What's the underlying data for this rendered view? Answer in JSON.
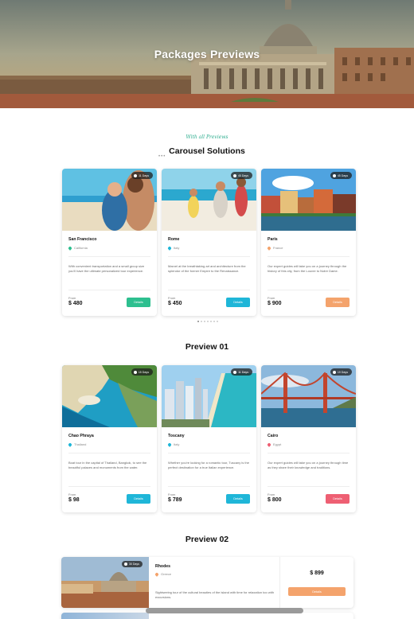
{
  "hero": {
    "title": "Packages Previews"
  },
  "carousel": {
    "script_label": "With all Previews",
    "title": "Carousel Solutions",
    "cards": [
      {
        "days": "11 Days",
        "name": "San Francisco",
        "location": "California",
        "desc": "With convenient transportation and a small group size you'll have the ultimate personalized tour experience.",
        "from": "From",
        "price": "$ 480",
        "button": "Details",
        "color": "#2dbf8f"
      },
      {
        "days": "45 Days",
        "name": "Rome",
        "location": "Italy",
        "desc": "Marvel at the breathtaking art and architecture from the splendor of the former Empire to the Renaissance.",
        "from": "From",
        "price": "$ 450",
        "button": "Details",
        "color": "#1fb6d8"
      },
      {
        "days": "45 Days",
        "name": "Paris",
        "location": "France",
        "desc": "Our expert guides will take you on a journey through the history of this city, from the Louvre to Notre Dame.",
        "from": "From",
        "price": "$ 900",
        "button": "Details",
        "color": "#f4a36c"
      }
    ]
  },
  "preview01": {
    "title": "Preview 01",
    "cards": [
      {
        "days": "15 Days",
        "name": "Chao Phraya",
        "location": "Thailand",
        "desc": "Boat tour in the capital of Thailand, Bangkok, to see the beautiful palaces and monuments from the water.",
        "from": "From",
        "price": "$ 98",
        "button": "Details",
        "color": "#1fb6d8"
      },
      {
        "days": "11 Days",
        "name": "Toscany",
        "location": "Italy",
        "desc": "Whether you're looking for a romantic tour, Tuscany is the perfect destination for a true Italian experience.",
        "from": "From",
        "price": "$ 789",
        "button": "Details",
        "color": "#1fb6d8"
      },
      {
        "days": "19 Days",
        "name": "Cairo",
        "location": "Egypt",
        "desc": "Our expert guides will take you on a journey through time as they share their knowledge and traditions.",
        "from": "From",
        "price": "$ 800",
        "button": "Details",
        "color": "#ee5f73"
      }
    ]
  },
  "preview02": {
    "title": "Preview 02",
    "card": {
      "days": "30 Days",
      "name": "Rhodes",
      "location": "Greece",
      "desc": "Sightseeing tour of the cultural beauties of the island with time for relaxation too with excursions.",
      "price": "$ 899",
      "button": "Details"
    }
  },
  "colors": {
    "pin_green": "#2dbf8f",
    "pin_blue": "#1fb6d8",
    "pin_orange": "#f4a36c",
    "pin_red": "#ee5f73"
  }
}
